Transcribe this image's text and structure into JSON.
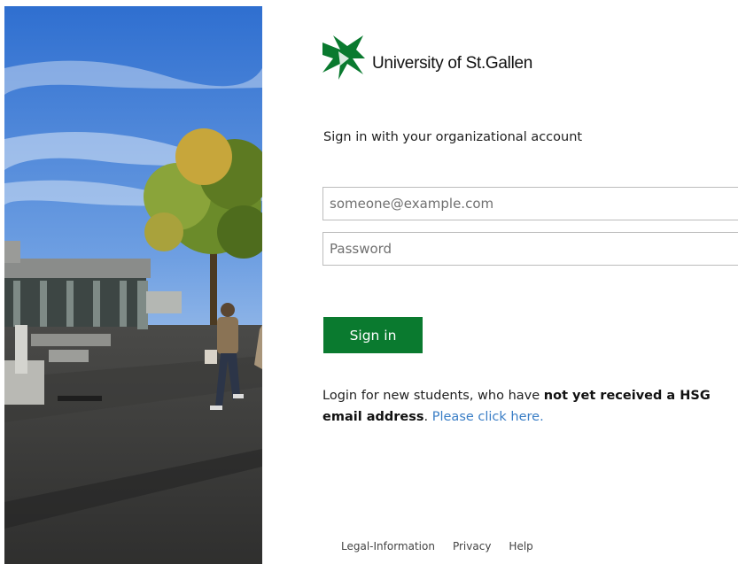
{
  "brand": {
    "name": "University of St.Gallen",
    "logo_icon": "hsg-logo-icon",
    "accent_color": "#0a7a2f"
  },
  "login": {
    "heading": "Sign in with your organizational account",
    "email": {
      "value": "",
      "placeholder": "someone@example.com"
    },
    "password": {
      "value": "",
      "placeholder": "Password"
    },
    "submit_label": "Sign in"
  },
  "new_students": {
    "text_before": "Login for new students, who have ",
    "bold_text": "not yet received a HSG email address",
    "text_after": ". ",
    "link_text": "Please click here.",
    "link_color": "#3a7ec6"
  },
  "footer": {
    "links": [
      "Legal-Information",
      "Privacy",
      "Help"
    ]
  }
}
